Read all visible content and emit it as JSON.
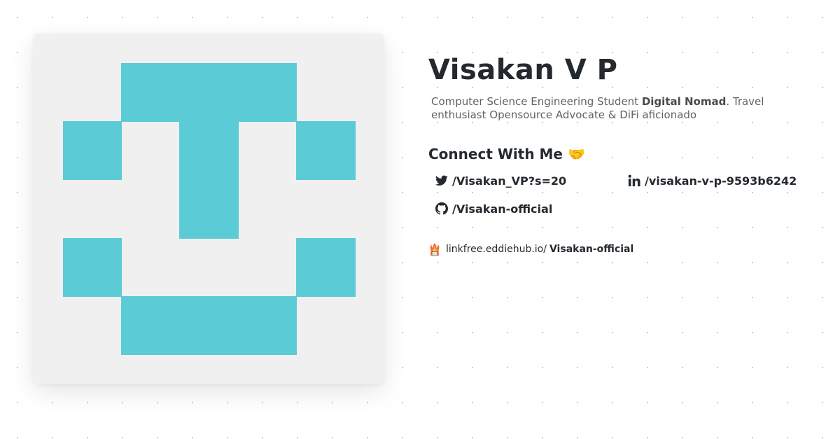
{
  "profile": {
    "name": "Visakan V P",
    "bio_part1": "Computer Science Engineering Student ",
    "bio_bold": "Digital Nomad",
    "bio_part2": ". Travel enthusiast Opensource Advocate & DiFi aficionado"
  },
  "avatar": {
    "background_color": "#f0f0f0",
    "block_color": "#5bcbd6"
  },
  "connect": {
    "heading": "Connect With Me",
    "heading_emoji": "🤝",
    "links": [
      {
        "platform": "twitter",
        "icon": "twitter-icon",
        "label": "/Visakan_VP?s=20"
      },
      {
        "platform": "linkedin",
        "icon": "linkedin-icon",
        "label": "/visakan-v-p-9593b6242"
      },
      {
        "platform": "github",
        "icon": "github-icon",
        "label": "/Visakan-official"
      }
    ]
  },
  "linkfree": {
    "icon": "linkfree-logo-icon",
    "prefix": "linkfree.eddiehub.io/",
    "handle": "Visakan-official"
  },
  "colors": {
    "text": "#24292f",
    "muted": "#5f6368",
    "accent": "#5bcbd6"
  }
}
